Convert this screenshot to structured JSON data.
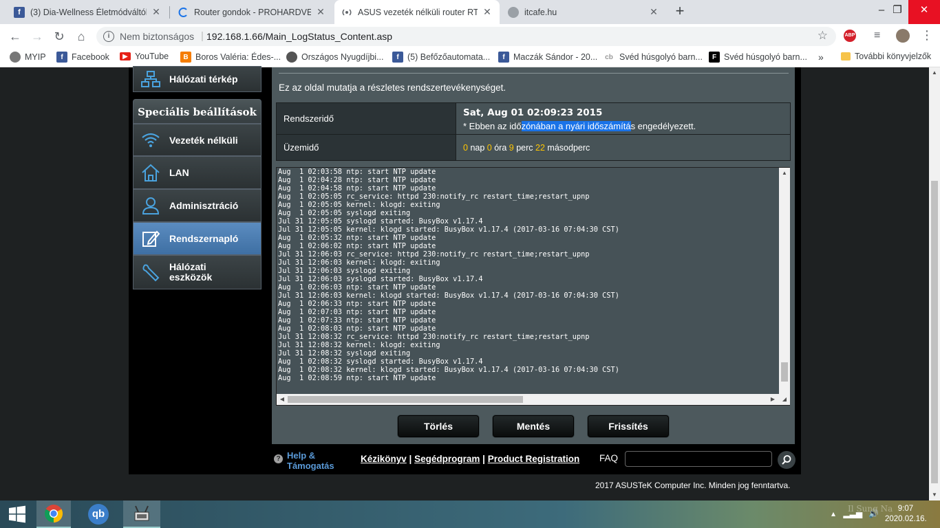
{
  "browser": {
    "tabs": [
      {
        "title": "(3) Dia-Wellness Életmódváltók",
        "icon": "facebook-icon"
      },
      {
        "title": "Router gondok - PROHARDVER!",
        "icon": "loading-icon"
      },
      {
        "title": "ASUS vezeték nélküli router RT-N",
        "icon": "router-icon"
      },
      {
        "title": "itcafe.hu",
        "icon": "globe-icon"
      }
    ],
    "security_label": "Nem biztonságos",
    "url": "192.168.1.66/Main_LogStatus_Content.asp",
    "bookmarks": [
      {
        "label": "MYIP",
        "icon": "globe-icon"
      },
      {
        "label": "Facebook",
        "icon": "facebook-icon"
      },
      {
        "label": "YouTube",
        "icon": "youtube-icon"
      },
      {
        "label": "Boros Valéria: Édes-...",
        "icon": "blogger-icon"
      },
      {
        "label": "Országos Nyugdíjbi...",
        "icon": "globe-icon"
      },
      {
        "label": "(5) Befőzőautomata...",
        "icon": "facebook-icon"
      },
      {
        "label": "Maczák Sándor - 20...",
        "icon": "facebook-icon"
      },
      {
        "label": "Svéd húsgolyó barn...",
        "icon": "cb-icon"
      },
      {
        "label": "Svéd húsgolyó barn...",
        "icon": "f-icon"
      }
    ],
    "more_bookmarks": "»",
    "other_bookmarks": "További könyvjelzők",
    "extension_label": "ABP"
  },
  "sidebar": {
    "network_map": "Hálózati térkép",
    "section_title": "Speciális beállítások",
    "items": [
      {
        "label": "Vezeték nélküli",
        "icon": "wifi-icon"
      },
      {
        "label": "LAN",
        "icon": "home-icon"
      },
      {
        "label": "Adminisztráció",
        "icon": "admin-user-icon"
      },
      {
        "label": "Rendszernapló",
        "icon": "log-edit-icon"
      },
      {
        "label": "Hálózati eszközök",
        "icon": "wrench-icon"
      }
    ],
    "active_index": 3
  },
  "content": {
    "description": "Ez az oldal mutatja a részletes rendszertevékenységet.",
    "system_time_label": "Rendszeridő",
    "system_time_value": "Sat, Aug 01 02:09:23 2015",
    "dst_note_pre": " * Ebben az idő",
    "dst_note_highlight": "zónában a nyári időszámítá",
    "dst_note_post": "s engedélyezett.",
    "uptime_label": "Üzemidő",
    "uptime": {
      "days": "0",
      "days_label": "nap",
      "hours": "0",
      "hours_label": "óra",
      "minutes": "9",
      "minutes_label": "perc",
      "seconds": "22",
      "seconds_label": "másodperc"
    },
    "log_lines": [
      "Aug  1 02:03:58 ntp: start NTP update",
      "Aug  1 02:04:28 ntp: start NTP update",
      "Aug  1 02:04:58 ntp: start NTP update",
      "Aug  1 02:05:05 rc_service: httpd 230:notify_rc restart_time;restart_upnp",
      "Aug  1 02:05:05 kernel: klogd: exiting",
      "Aug  1 02:05:05 syslogd exiting",
      "Jul 31 12:05:05 syslogd started: BusyBox v1.17.4",
      "Jul 31 12:05:05 kernel: klogd started: BusyBox v1.17.4 (2017-03-16 07:04:30 CST)",
      "Aug  1 02:05:32 ntp: start NTP update",
      "Aug  1 02:06:02 ntp: start NTP update",
      "Jul 31 12:06:03 rc_service: httpd 230:notify_rc restart_time;restart_upnp",
      "Jul 31 12:06:03 kernel: klogd: exiting",
      "Jul 31 12:06:03 syslogd exiting",
      "Jul 31 12:06:03 syslogd started: BusyBox v1.17.4",
      "Aug  1 02:06:03 ntp: start NTP update",
      "Jul 31 12:06:03 kernel: klogd started: BusyBox v1.17.4 (2017-03-16 07:04:30 CST)",
      "Aug  1 02:06:33 ntp: start NTP update",
      "Aug  1 02:07:03 ntp: start NTP update",
      "Aug  1 02:07:33 ntp: start NTP update",
      "Aug  1 02:08:03 ntp: start NTP update",
      "Jul 31 12:08:32 rc_service: httpd 230:notify_rc restart_time;restart_upnp",
      "Jul 31 12:08:32 kernel: klogd: exiting",
      "Jul 31 12:08:32 syslogd exiting",
      "Aug  1 02:08:32 syslogd started: BusyBox v1.17.4",
      "Aug  1 02:08:32 kernel: klogd started: BusyBox v1.17.4 (2017-03-16 07:04:30 CST)",
      "Aug  1 02:08:59 ntp: start NTP update"
    ],
    "buttons": {
      "clear": "Törlés",
      "save": "Mentés",
      "refresh": "Frissítés"
    }
  },
  "footer": {
    "help_line1": "Help &",
    "help_line2": "Támogatás",
    "manual": "Kézikönyv",
    "utility": "Segédprogram",
    "registration": "Product Registration",
    "separator": "|",
    "faq": "FAQ",
    "faq_placeholder": "",
    "copyright": "2017 ASUSTeK Computer Inc. Minden jog fenntartva."
  },
  "taskbar": {
    "clock_time": "9:07",
    "clock_date": "2020.02.16.",
    "watermark": "Il Sung Na"
  },
  "colors": {
    "accent_number": "#ffc600",
    "panel": "#4d595d",
    "active_menu": "#4a7db3",
    "link_blue": "#5a9ad8"
  }
}
